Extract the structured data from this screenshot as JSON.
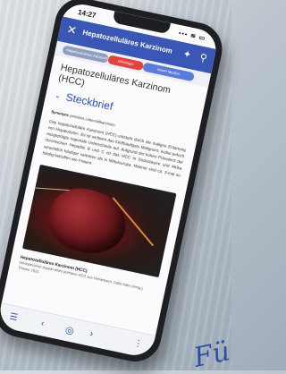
{
  "status": {
    "time": "14:27",
    "signal": "▪▪▪ ≋ ▭"
  },
  "appbar": {
    "title": "Hepatozelluläres Karzinom",
    "close_icon": "close-icon",
    "star_icon": "star-icon",
    "search_icon": "search-icon"
  },
  "chips": [
    "Hepatozelluläres Karzinom",
    "Onkologie",
    "Innere Medizin"
  ],
  "article": {
    "heading": "Hepatozelluläres Karzinom (HCC)",
    "section_title": "Steckbrief",
    "synonyms_label": "Synonym:",
    "synonyms_value": "primäres Leberzellkarzinom",
    "paragraph": "Das hepatozelluläre Karzinom (HCC) entsteht durch die maligne Entartung von Hepatozyten. Es ist weltweit das fünfthäufigste Malignom, wobei jedoch ausgeprägte regionale Unterschiede auf. Aufgrund der hohen Prävalenz der chronischen Hepatitis B und C ist das HCC in Südostasien und Afrika wesentlich häufiger vertreten als in Mitteleuropa. Männer sind ca. 3-mal so häufig betroffen wie Frauen.",
    "caption_title": "Hepatozelluläres Karzinom (HCC)",
    "caption_text": "Intraoperativer Aspekt eines primären HCC aus Heinemann, Gallo Hahn (Hrsg.), Thieme 2010"
  },
  "bottom": {
    "menu": "☰",
    "prev": "‹",
    "center": "◎",
    "next": "›",
    "more": "⋮"
  },
  "corner_text": "Fü"
}
